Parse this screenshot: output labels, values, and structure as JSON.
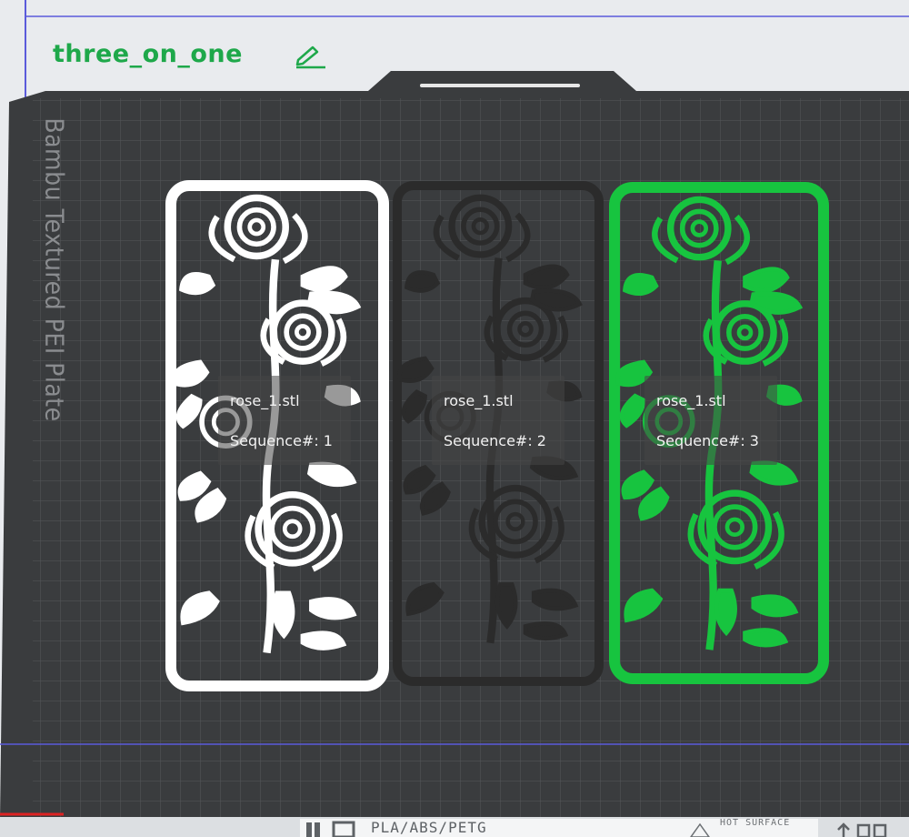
{
  "plate": {
    "name": "three_on_one",
    "edit_icon": "pencil-edit-icon",
    "bed_label": "Bambu Textured PEI Plate",
    "material_text": "PLA/ABS/PETG",
    "hot_surface_text": "HOT SURFACE"
  },
  "objects": [
    {
      "name": "rose_1.stl",
      "sequence": "Sequence#: 1",
      "color": "#ffffff"
    },
    {
      "name": "rose_1.stl",
      "sequence": "Sequence#: 2",
      "color": "#2b2b2b"
    },
    {
      "name": "rose_1.stl",
      "sequence": "Sequence#: 3",
      "color": "#17c43f"
    }
  ],
  "colors": {
    "bed": "#3a3c3e",
    "grid": "#55585b",
    "accent": "#1ea84a",
    "boundary": "#5b5bdb"
  }
}
